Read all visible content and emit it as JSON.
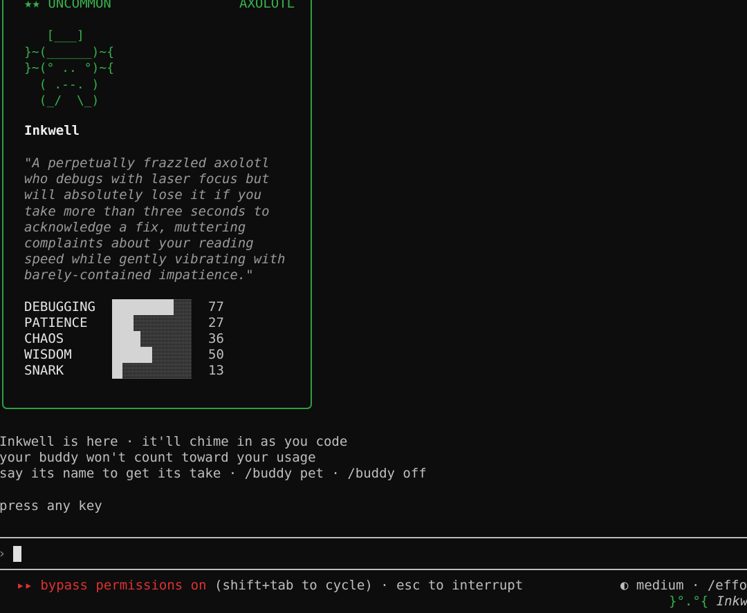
{
  "card": {
    "rarity": "★★ UNCOMMON",
    "species": "AXOLOTL",
    "ascii_art": "   [___]\n}~(______)~{\n}~(° .. °)~{\n  ( .--. )\n  (_/  \\_)",
    "name": "Inkwell",
    "quote": "\"A perpetually frazzled axolotl\nwho debugs with laser focus but\nwill absolutely lose it if you\ntake more than three seconds to\nacknowledge a fix, muttering\ncomplaints about your reading\nspeed while gently vibrating with\nbarely-contained impatience.\"",
    "stats": [
      {
        "label": "DEBUGGING",
        "value": "77",
        "level": 0.77
      },
      {
        "label": "PATIENCE",
        "value": "27",
        "level": 0.27
      },
      {
        "label": "CHAOS",
        "value": "36",
        "level": 0.36
      },
      {
        "label": "WISDOM",
        "value": "50",
        "level": 0.5
      },
      {
        "label": "SNARK",
        "value": "13",
        "level": 0.13
      }
    ]
  },
  "messages": {
    "line1": "Inkwell is here · it'll chime in as you code",
    "line2": "your buddy won't count toward your usage",
    "line3": "say its name to get its take · /buddy pet · /buddy off",
    "line4": "press any key"
  },
  "prompt": {
    "chevron": "›"
  },
  "status": {
    "mode_arrows": "▸▸",
    "mode_label": "bypass permissions on",
    "mode_hint": "(shift+tab to cycle) · esc to interrupt",
    "effort_icon": "◐",
    "effort": "medium · /effo",
    "buddy_face": "}°.°{",
    "buddy_name": "Inkw"
  },
  "colors": {
    "accent_green": "#37b24d",
    "border_green": "#2f9e44",
    "warning_red": "#e03131",
    "background": "#0d0d0d"
  }
}
